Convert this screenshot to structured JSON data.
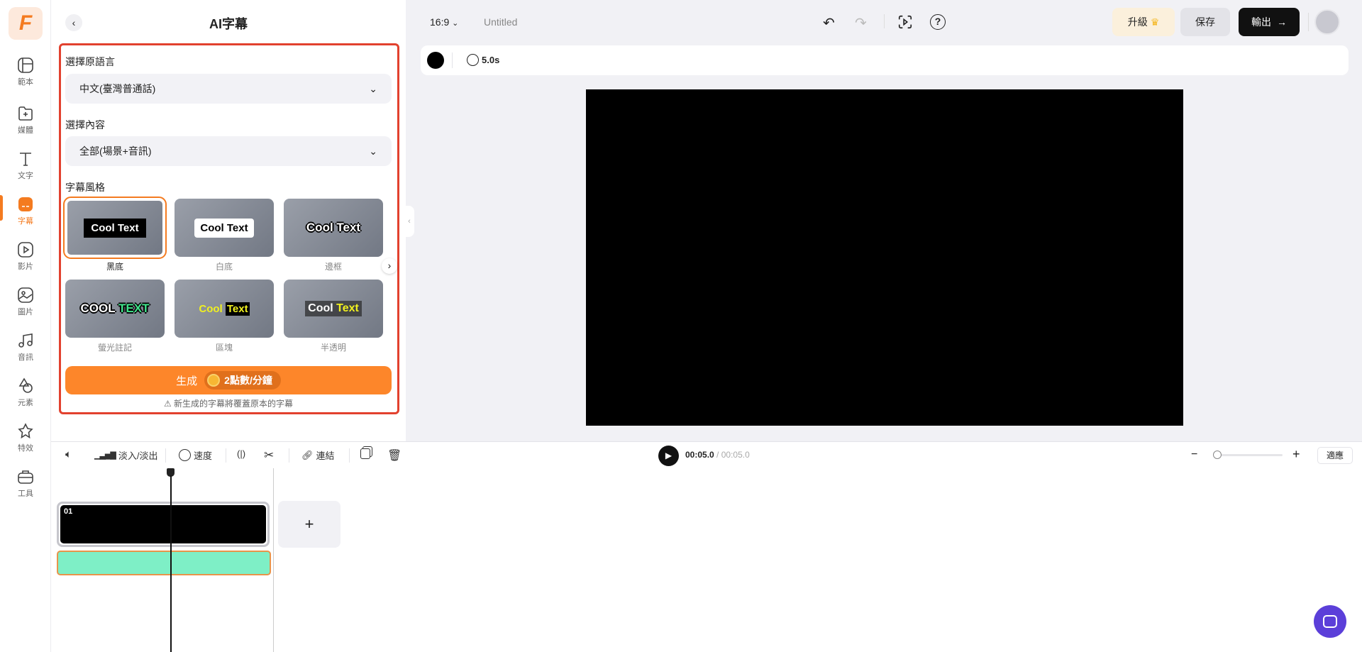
{
  "rail": {
    "logo": "F",
    "items": [
      {
        "label": "範本",
        "icon": "template-icon"
      },
      {
        "label": "媒體",
        "icon": "media-folder-icon"
      },
      {
        "label": "文字",
        "icon": "text-icon"
      },
      {
        "label": "字幕",
        "icon": "subtitle-icon",
        "active": true
      },
      {
        "label": "影片",
        "icon": "video-icon"
      },
      {
        "label": "圖片",
        "icon": "image-icon"
      },
      {
        "label": "音訊",
        "icon": "music-icon"
      },
      {
        "label": "元素",
        "icon": "shapes-icon"
      },
      {
        "label": "特效",
        "icon": "effects-icon"
      },
      {
        "label": "工具",
        "icon": "toolbox-icon"
      }
    ]
  },
  "panel": {
    "title": "AI字幕",
    "language_label": "選擇原語言",
    "language_value": "中文(臺灣普通話)",
    "content_label": "選擇內容",
    "content_value": "全部(場景+音訊)",
    "style_label": "字幕風格",
    "styles": [
      {
        "name": "黑底",
        "sample": "Cool Text",
        "selected": true
      },
      {
        "name": "白底",
        "sample": "Cool Text"
      },
      {
        "name": "邊框",
        "sample": "Cool Text"
      },
      {
        "name": "螢光註記",
        "sample_a": "COOL",
        "sample_b": "TEXT"
      },
      {
        "name": "區塊",
        "sample_a": "Cool",
        "sample_b": "Text"
      },
      {
        "name": "半透明",
        "sample_a": "Cool",
        "sample_b": "Text"
      }
    ],
    "generate_label": "生成",
    "cost": "2點數/分鐘",
    "warning": "新生成的字幕將覆蓋原本的字幕"
  },
  "topbar": {
    "ratio": "16:9",
    "project_name": "Untitled",
    "upgrade": "升級",
    "save": "保存",
    "export": "輸出"
  },
  "subbar": {
    "duration": "5.0s",
    "color": "#000000"
  },
  "timeline": {
    "tools": {
      "fade": "淡入/淡出",
      "speed": "速度",
      "link": "連結"
    },
    "current_time": "00:05.0",
    "total_time": "/ 00:05.0",
    "fit": "適應",
    "clip_label": "01",
    "zoom_level": 0.0,
    "add": "+"
  },
  "colors": {
    "accent": "#f47b20",
    "highlight_box": "#e2412e",
    "audio_track": "#7eefc6",
    "chat": "#5b3fd9"
  }
}
